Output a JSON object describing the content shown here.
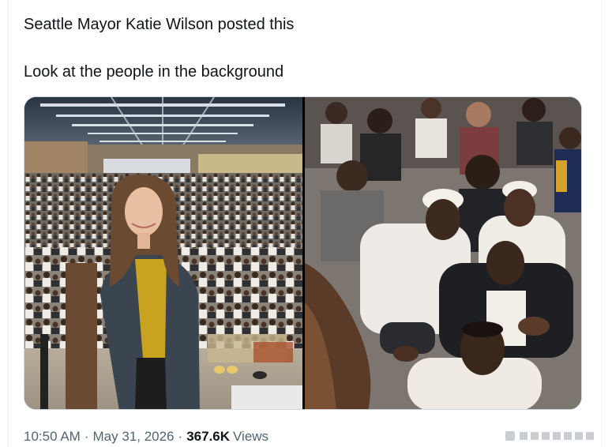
{
  "tweet": {
    "lines": [
      "Seattle Mayor Katie Wilson posted this",
      "Look at the people in the background"
    ]
  },
  "media": {
    "left_photo": "photo of a woman standing in front of a large crowd seated on a convention hall floor",
    "right_photo": "close-up photo of seated men in the crowd"
  },
  "meta": {
    "time": "10:50 AM",
    "separator": "·",
    "date": "May 31, 2026",
    "views_count": "367.6K",
    "views_label": "Views"
  },
  "colors": {
    "text_primary": "#0f1419",
    "text_secondary": "#536471",
    "border": "#cfd9de"
  },
  "icons": [
    "photo-left-image",
    "photo-right-image",
    "watermark-icon"
  ]
}
